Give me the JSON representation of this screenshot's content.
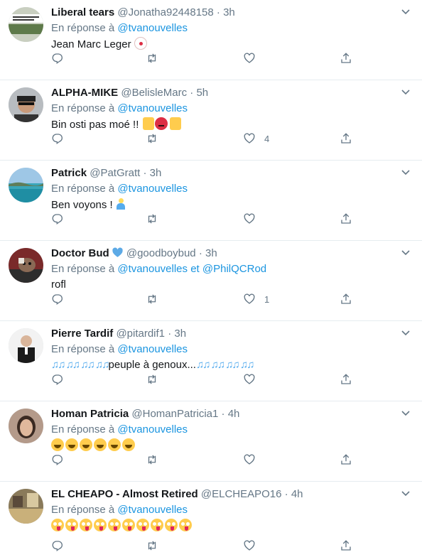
{
  "reply_prefix": "En réponse à",
  "tweets": [
    {
      "name": "Liberal tears",
      "handle": "@Jonatha92448158",
      "sep": "·",
      "time": "3h",
      "reply_to": [
        "@tvanouvelles"
      ],
      "text": "Jean Marc Leger",
      "like_count": ""
    },
    {
      "name": "ALPHA-MIKE",
      "handle": "@BelisleMarc",
      "sep": "·",
      "time": "5h",
      "reply_to": [
        "@tvanouvelles"
      ],
      "text": "Bin osti pas moé !!",
      "like_count": "4"
    },
    {
      "name": "Patrick",
      "handle": "@PatGratt",
      "sep": "·",
      "time": "3h",
      "reply_to": [
        "@tvanouvelles"
      ],
      "text": "Ben voyons !",
      "like_count": ""
    },
    {
      "name": "Doctor Bud",
      "handle": "@goodboybud",
      "sep": "·",
      "time": "3h",
      "reply_to": [
        "@tvanouvelles",
        "@PhilQCRod"
      ],
      "reply_joiner": "et",
      "text": "rofl",
      "like_count": "1"
    },
    {
      "name": "Pierre Tardif",
      "handle": "@pitardif1",
      "sep": "·",
      "time": "3h",
      "reply_to": [
        "@tvanouvelles"
      ],
      "text_after_notes": "peuple à genoux...",
      "like_count": ""
    },
    {
      "name": "Homan Patricia",
      "handle": "@HomanPatricia1",
      "sep": "·",
      "time": "4h",
      "reply_to": [
        "@tvanouvelles"
      ],
      "like_count": ""
    },
    {
      "name": "EL CHEAPO - Almost Retired",
      "handle": "@ELCHEAPO16",
      "sep": "·",
      "time": "4h",
      "reply_to": [
        "@tvanouvelles"
      ],
      "like_count": ""
    }
  ],
  "icons": [
    "reply-icon",
    "retweet-icon",
    "like-icon",
    "share-icon",
    "caret-down-icon",
    "verified-heart-icon"
  ],
  "colors": {
    "link": "#1b95e0",
    "muted": "#657786",
    "text": "#14171a",
    "divider": "#e6ecf0"
  }
}
